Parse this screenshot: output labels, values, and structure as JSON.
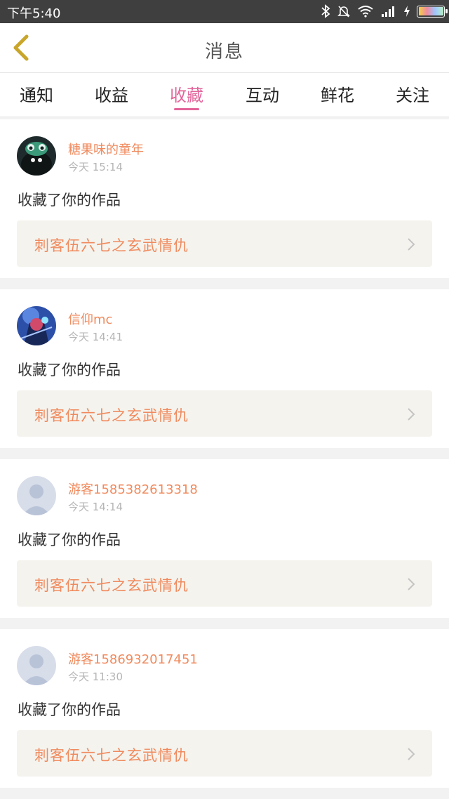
{
  "status_bar": {
    "time": "下午5:40",
    "bluetooth_icon": "bluetooth-icon",
    "mute_icon": "bell-off-icon",
    "wifi_icon": "wifi-icon",
    "signal_icon": "signal-icon",
    "charge_icon": "bolt-icon"
  },
  "header": {
    "title": "消息",
    "back_icon": "chevron-left-icon"
  },
  "tabs": [
    {
      "label": "通知"
    },
    {
      "label": "收益"
    },
    {
      "label": "收藏",
      "active": true
    },
    {
      "label": "互动"
    },
    {
      "label": "鲜花"
    },
    {
      "label": "关注"
    }
  ],
  "items": [
    {
      "user": "糖果味的童年",
      "time": "今天 15:14",
      "action": "收藏了你的作品",
      "work_title": "刺客伍六七之玄武情仇",
      "avatar": "avatar-dark-character"
    },
    {
      "user": "信仰mc",
      "time": "今天 14:41",
      "action": "收藏了你的作品",
      "work_title": "刺客伍六七之玄武情仇",
      "avatar": "avatar-blue-character"
    },
    {
      "user": "游客1585382613318",
      "time": "今天 14:14",
      "action": "收藏了你的作品",
      "work_title": "刺客伍六七之玄武情仇",
      "avatar": "avatar-default"
    },
    {
      "user": "游客1586932017451",
      "time": "今天 11:30",
      "action": "收藏了你的作品",
      "work_title": "刺客伍六七之玄武情仇",
      "avatar": "avatar-default"
    }
  ],
  "colors": {
    "accent": "#e2649a",
    "username": "#f08a5d",
    "work_bg": "#f4f3ee",
    "back_icon": "#c9a62a"
  }
}
